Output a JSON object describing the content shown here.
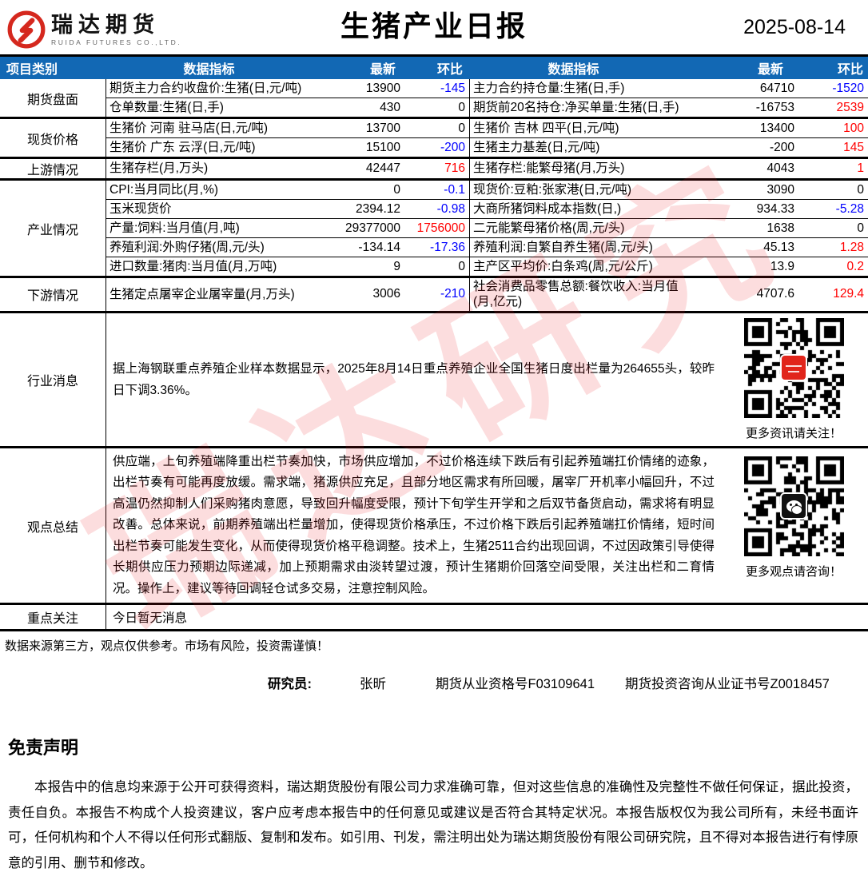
{
  "colors_map": {
    "red": "#FF0000",
    "blue": "#0000FF",
    "black": "#000000"
  },
  "header": {
    "logo_cn": "瑞达期货",
    "logo_en": "RUIDA FUTURES CO.,LTD.",
    "title": "生猪产业日报",
    "date": "2025-08-14"
  },
  "table": {
    "col_headers": {
      "category": "项目类别",
      "indicator": "数据指标",
      "latest": "最新",
      "mom": "环比"
    },
    "sections": [
      {
        "category": "期货盘面",
        "rows": [
          {
            "left": {
              "indicator": "期货主力合约收盘价:生猪(日,元/吨)",
              "latest": "13900",
              "chg": "-145",
              "chg_color": "blue"
            },
            "right": {
              "indicator": "主力合约持仓量:生猪(日,手)",
              "latest": "64710",
              "chg": "-1520",
              "chg_color": "blue"
            }
          },
          {
            "left": {
              "indicator": "仓单数量:生猪(日,手)",
              "latest": "430",
              "chg": "0",
              "chg_color": "black"
            },
            "right": {
              "indicator": "期货前20名持仓:净买单量:生猪(日,手)",
              "latest": "-16753",
              "chg": "2539",
              "chg_color": "red"
            }
          }
        ]
      },
      {
        "category": "现货价格",
        "rows": [
          {
            "left": {
              "indicator": "生猪价 河南 驻马店(日,元/吨)",
              "latest": "13700",
              "chg": "0",
              "chg_color": "black"
            },
            "right": {
              "indicator": "生猪价 吉林 四平(日,元/吨)",
              "latest": "13400",
              "chg": "100",
              "chg_color": "red"
            }
          },
          {
            "left": {
              "indicator": "生猪价 广东 云浮(日,元/吨)",
              "latest": "15100",
              "chg": "-200",
              "chg_color": "blue"
            },
            "right": {
              "indicator": "生猪主力基差(日,元/吨)",
              "latest": "-200",
              "chg": "145",
              "chg_color": "red"
            }
          }
        ]
      },
      {
        "category": "上游情况",
        "rows": [
          {
            "left": {
              "indicator": "生猪存栏(月,万头)",
              "latest": "42447",
              "chg": "716",
              "chg_color": "red"
            },
            "right": {
              "indicator": "生猪存栏:能繁母猪(月,万头)",
              "latest": "4043",
              "chg": "1",
              "chg_color": "red"
            }
          }
        ]
      },
      {
        "category": "产业情况",
        "rows": [
          {
            "left": {
              "indicator": "CPI:当月同比(月,%)",
              "latest": "0",
              "chg": "-0.1",
              "chg_color": "blue"
            },
            "right": {
              "indicator": "现货价:豆粕:张家港(日,元/吨)",
              "latest": "3090",
              "chg": "0",
              "chg_color": "black"
            }
          },
          {
            "left": {
              "indicator": "玉米现货价",
              "latest": "2394.12",
              "chg": "-0.98",
              "chg_color": "blue"
            },
            "right": {
              "indicator": "大商所猪饲料成本指数(日,)",
              "latest": "934.33",
              "chg": "-5.28",
              "chg_color": "blue"
            }
          },
          {
            "left": {
              "indicator": "产量:饲料:当月值(月,吨)",
              "latest": "29377000",
              "chg": "1756000",
              "chg_color": "red"
            },
            "right": {
              "indicator": "二元能繁母猪价格(周,元/头)",
              "latest": "1638",
              "chg": "0",
              "chg_color": "black"
            }
          },
          {
            "left": {
              "indicator": "养殖利润:外购仔猪(周,元/头)",
              "latest": "-134.14",
              "chg": "-17.36",
              "chg_color": "blue"
            },
            "right": {
              "indicator": "养殖利润:自繁自养生猪(周,元/头)",
              "latest": "45.13",
              "chg": "1.28",
              "chg_color": "red"
            }
          },
          {
            "left": {
              "indicator": "进口数量:猪肉:当月值(月,万吨)",
              "latest": "9",
              "chg": "0",
              "chg_color": "black"
            },
            "right": {
              "indicator": "主产区平均价:白条鸡(周,元/公斤)",
              "latest": "13.9",
              "chg": "0.2",
              "chg_color": "red"
            }
          }
        ]
      },
      {
        "category": "下游情况",
        "rows": [
          {
            "left": {
              "indicator": "生猪定点屠宰企业屠宰量(月,万头)",
              "latest": "3006",
              "chg": "-210",
              "chg_color": "blue"
            },
            "right": {
              "indicator": "社会消费品零售总额:餐饮收入:当月值(月,亿元)",
              "latest": "4707.6",
              "chg": "129.4",
              "chg_color": "red"
            }
          }
        ]
      }
    ],
    "news": {
      "category": "行业消息",
      "text": "据上海钢联重点养殖企业样本数据显示，2025年8月14日重点养殖企业全国生猪日度出栏量为264655头，较昨日下调3.36%。",
      "qr_caption": "更多资讯请关注！"
    },
    "opinion": {
      "category": "观点总结",
      "text": "供应端，上旬养殖端降重出栏节奏加快，市场供应增加，不过价格连续下跌后有引起养殖端扛价情绪的迹象，出栏节奏有可能再度放缓。需求端，猪源供应充足，且部分地区需求有所回暖，屠宰厂开机率小幅回升，不过高温仍然抑制人们采购猪肉意愿，导致回升幅度受限，预计下旬学生开学和之后双节备货启动，需求将有明显改善。总体来说，前期养殖端出栏量增加，使得现货价格承压，不过价格下跌后引起养殖端扛价情绪，短时间出栏节奏可能发生变化，从而使得现货价格平稳调整。技术上，生猪2511合约出现回调，不过因政策引导使得长期供应压力预期边际递减，加上预期需求由淡转望过渡，预计生猪期价回落空间受限，关注出栏和二育情况。操作上，建议等待回调轻仓试多交易，注意控制风险。",
      "qr_caption": "更多观点请咨询！"
    },
    "focus": {
      "category": "重点关注",
      "text": "今日暂无消息"
    }
  },
  "footer": {
    "source_note": "数据来源第三方，观点仅供参考。市场有风险，投资需谨慎！",
    "researcher_label": "研究员:",
    "researcher_name": "张昕",
    "qualification": "期货从业资格号F03109641",
    "advisor_cert": "期货投资咨询从业证书号Z0018457"
  },
  "statement": {
    "title": "免责声明",
    "body": "本报告中的信息均来源于公开可获得资料，瑞达期货股份有限公司力求准确可靠，但对这些信息的准确性及完整性不做任何保证，据此投资，责任自负。本报告不构成个人投资建议，客户应考虑本报告中的任何意见或建议是否符合其特定状况。本报告版权仅为我公司所有，未经书面许可，任何机构和个人不得以任何形式翻版、复制和发布。如引用、刊发，需注明出处为瑞达期货股份有限公司研究院，且不得对本报告进行有悖原意的引用、删节和修改。",
    "watermark": "瑞达研究"
  }
}
